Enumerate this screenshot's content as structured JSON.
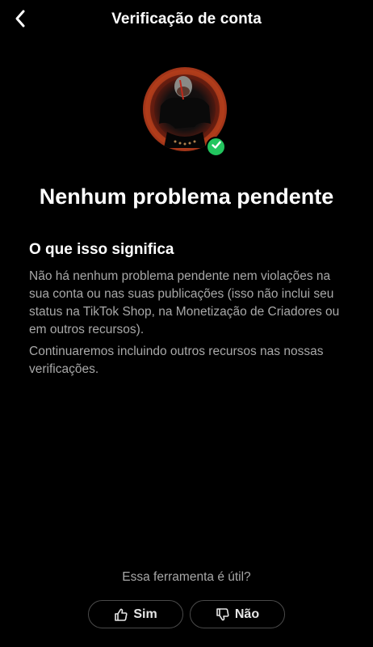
{
  "header": {
    "title": "Verificação de conta",
    "back_icon": "chevron-left-icon"
  },
  "status": {
    "title": "Nenhum problema pendente",
    "badge_icon": "check-circle-icon",
    "badge_color": "#22c55e"
  },
  "meaning": {
    "heading": "O que isso significa",
    "paragraph_1": "Não há nenhum problema pendente nem violações na sua conta ou nas suas publicações (isso não inclui seu status na TikTok Shop, na Monetização de Criadores ou em outros recursos).",
    "paragraph_2": "Continuaremos incluindo outros recursos nas nossas verificações."
  },
  "feedback": {
    "question": "Essa ferramenta é útil?",
    "yes_label": "Sim",
    "yes_icon": "thumbs-up-icon",
    "no_label": "Não",
    "no_icon": "thumbs-down-icon"
  },
  "colors": {
    "background": "#000000",
    "text_primary": "#ffffff",
    "text_secondary": "#a8a8a8",
    "button_border": "#4a4a4a"
  }
}
